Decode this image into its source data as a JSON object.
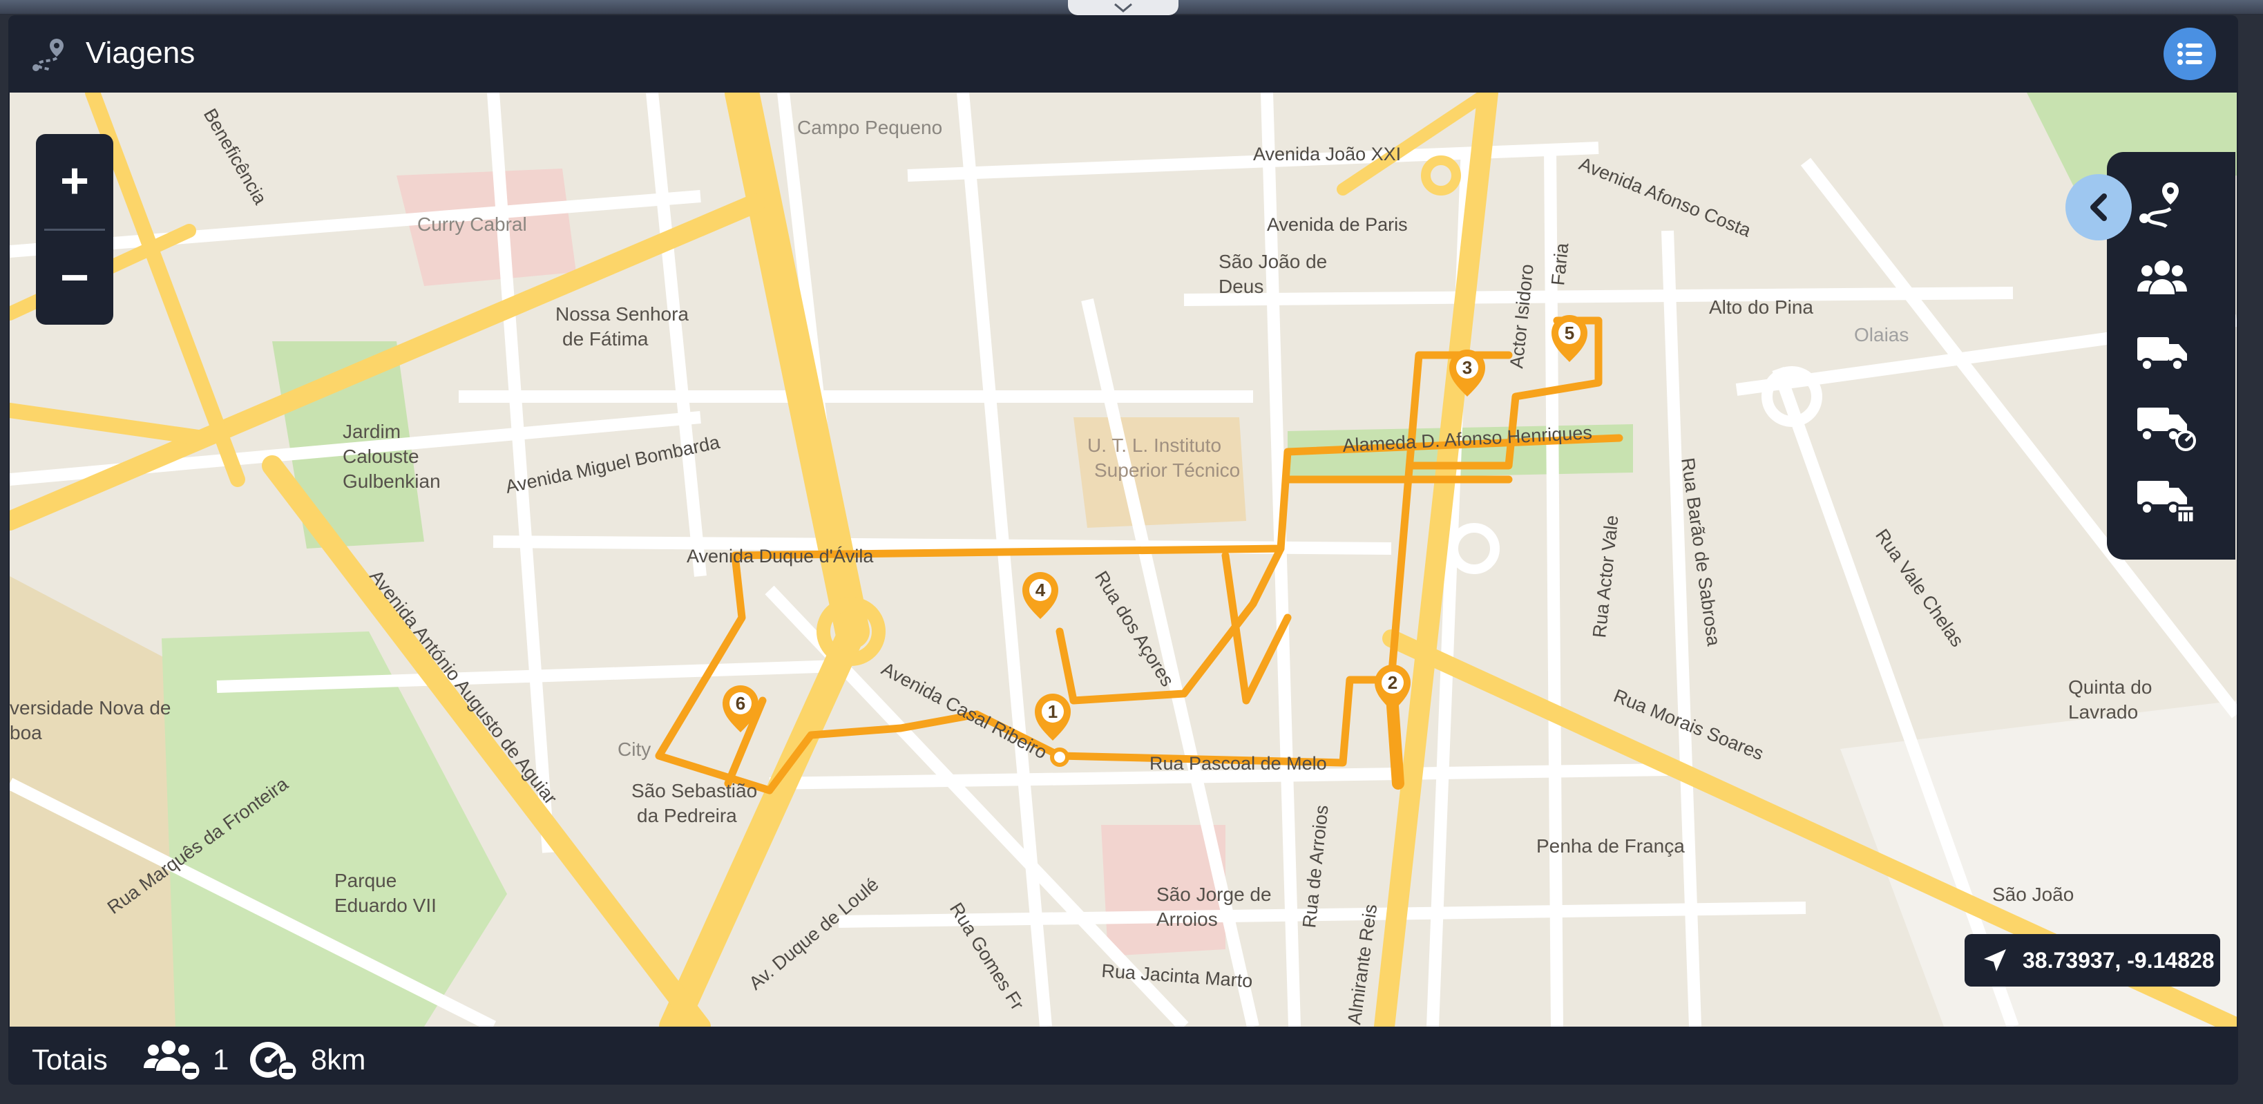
{
  "app": {
    "title": "Viagens"
  },
  "header": {
    "route_icon": "route-pin-icon",
    "list_icon": "list-icon"
  },
  "map": {
    "zoom_in_label": "+",
    "zoom_out_label": "−",
    "route_color": "#f7a21b",
    "labels": {
      "campo_pequeno": "Campo Pequeno",
      "curry_cabral": "Curry Cabral",
      "nossa_senhora": "Nossa Senhora",
      "de_fatima": "de Fátima",
      "jardim": "Jardim",
      "calouste": "Calouste",
      "gulbenkian": "Gulbenkian",
      "sao_joao_de_deus_1": "São João de",
      "sao_joao_de_deus_2": "Deus",
      "utl_1": "U. T. L. Instituto",
      "utl_2": "Superior Técnico",
      "alto_do_pina": "Alto do Pina",
      "olaias": "Olaias",
      "quinta_do_lavrado_1": "Quinta do",
      "quinta_do_lavrado_2": "Lavrado",
      "penha_de_franca": "Penha de França",
      "sao_joao": "São João",
      "sao_jorge_1": "São Jorge de",
      "sao_jorge_2": "Arroios",
      "parque_1": "Parque",
      "parque_2": "Eduardo VII",
      "sao_sebastiao_1": "São Sebastião",
      "sao_sebastiao_2": "da Pedreira",
      "universidade_1": "versidade Nova de",
      "universidade_2": "boa",
      "city": "City"
    },
    "streets": {
      "joao_xxi": "Avenida João XXI",
      "afonso_costa": "Avenida Afonso Costa",
      "avenida_paris": "Avenida de Paris",
      "miguel_bombarda": "Avenida Miguel Bombarda",
      "duque_avila": "Avenida Duque d'Ávila",
      "antonio_augusto": "Avenida António Augusto de Aguiar",
      "marques_fronteira": "Rua Marquês da Fronteira",
      "rua_acores": "Rua dos Açores",
      "casal_ribeiro": "Avenida Casal Ribeiro",
      "pascoal_melo": "Rua Pascoal de Melo",
      "rovisco_pais": "Alameda D. Afonso Henriques",
      "morais_soares": "Rua Morais Soares",
      "vale_chelas": "Rua Vale Chelas",
      "barao_sabrosa": "Rua Barão de Sabrosa",
      "actor_vale": "Rua Actor Vale",
      "actor_isidoro": "Actor Isidoro",
      "arroios": "Rua de Arroios",
      "gomes_freire": "Rua Gomes Fr",
      "duque_loule": "Av. Duque de Loulé",
      "jacinta_marto": "Rua Jacinta Marto",
      "almirante_reis": "Almirante Reis",
      "beneficencia": "Beneficência",
      "faria": "Faria"
    },
    "stops": [
      "1",
      "2",
      "3",
      "4",
      "5",
      "6"
    ]
  },
  "sidebar": {
    "collapse_icon": "chevron-left-icon",
    "items": [
      {
        "icon": "route-icon"
      },
      {
        "icon": "users-icon"
      },
      {
        "icon": "truck-icon"
      },
      {
        "icon": "truck-speed-icon"
      },
      {
        "icon": "truck-calendar-icon"
      }
    ]
  },
  "coords": {
    "value": "38.73937, -9.14828",
    "icon": "navigation-arrow-icon"
  },
  "footer": {
    "label": "Totais",
    "persons_icon": "users-minus-icon",
    "persons_count": "1",
    "distance_icon": "speedometer-minus-icon",
    "distance": "8km"
  }
}
